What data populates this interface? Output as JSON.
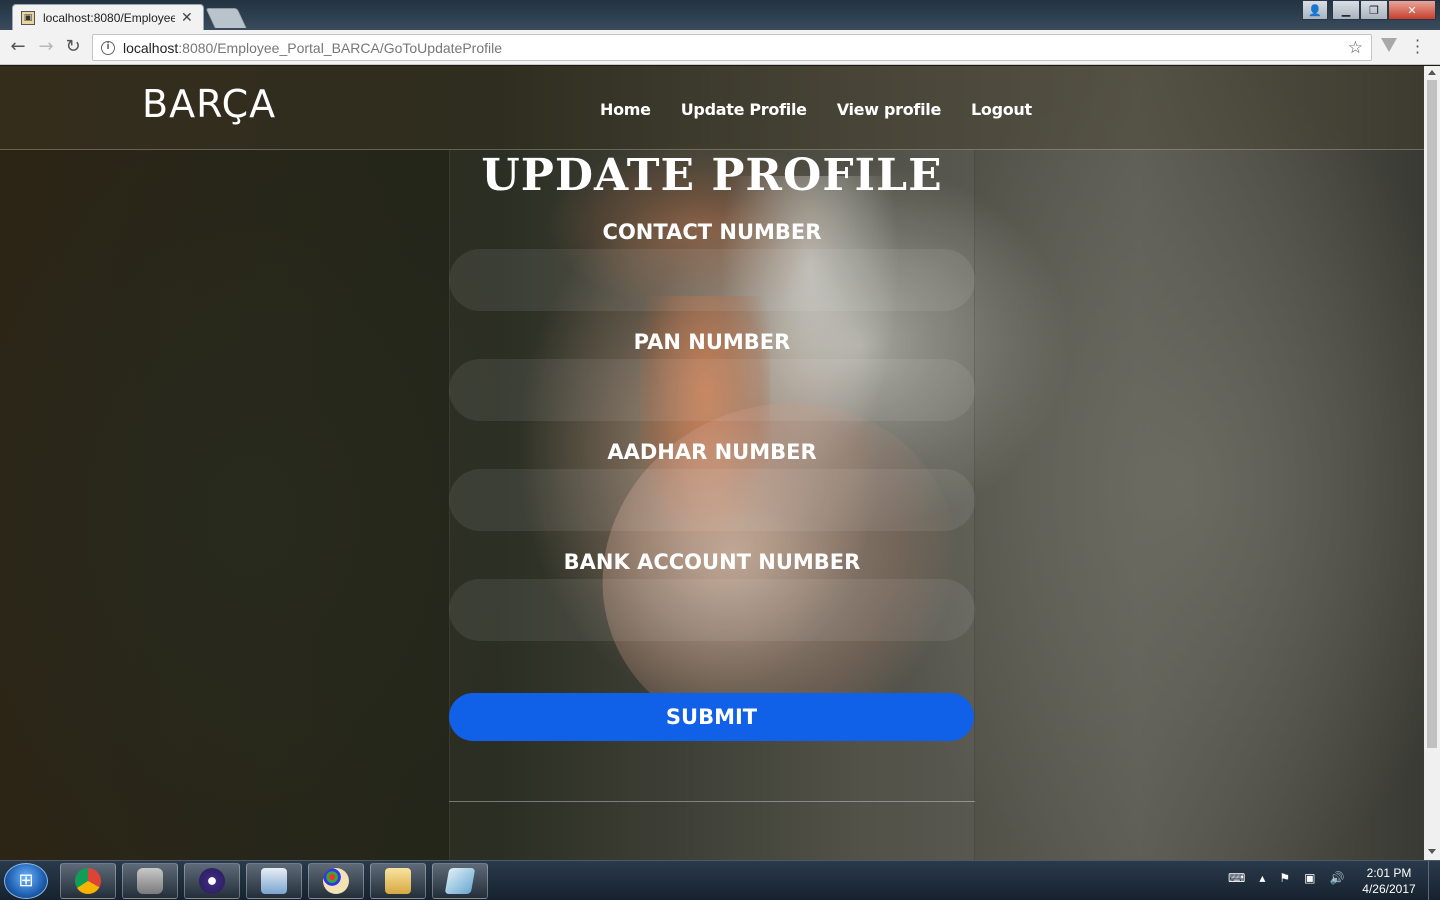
{
  "browser": {
    "tab_title": "localhost:8080/Employee",
    "url_host": "localhost",
    "url_rest": ":8080/Employee_Portal_BARCA/GoToUpdateProfile"
  },
  "site": {
    "brand": "BARÇA",
    "nav": [
      "Home",
      "Update Profile",
      "View profile",
      "Logout"
    ]
  },
  "form": {
    "title": "UPDATE PROFILE",
    "fields": [
      {
        "label": "CONTACT NUMBER",
        "value": ""
      },
      {
        "label": "PAN NUMBER",
        "value": ""
      },
      {
        "label": "AADHAR NUMBER",
        "value": ""
      },
      {
        "label": "BANK ACCOUNT NUMBER",
        "value": ""
      }
    ],
    "submit_label": "SUBMIT"
  },
  "taskbar": {
    "clock_time": "2:01 PM",
    "clock_date": "4/26/2017"
  },
  "colors": {
    "submit": "#1060e8",
    "text": "#ffffff"
  }
}
